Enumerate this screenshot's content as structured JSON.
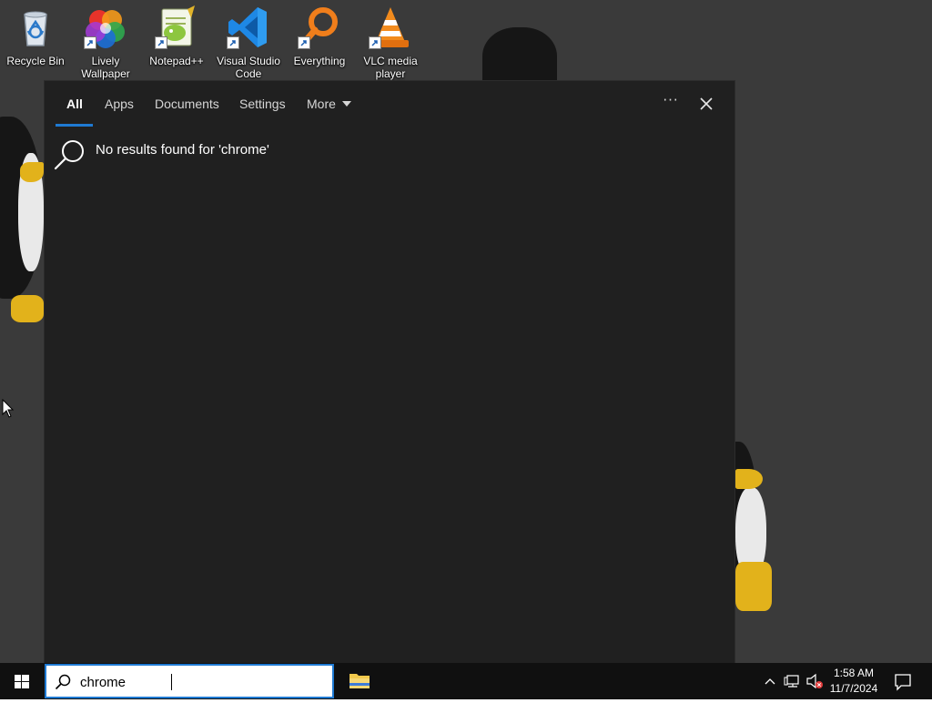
{
  "desktop": {
    "icons": [
      {
        "label": "Recycle Bin",
        "icon": "recycle-bin-icon"
      },
      {
        "label": "Lively Wallpaper",
        "icon": "lively-wallpaper-icon"
      },
      {
        "label": "Notepad++",
        "icon": "notepad-plus-plus-icon"
      },
      {
        "label": "Visual Studio Code",
        "icon": "vscode-icon"
      },
      {
        "label": "Everything",
        "icon": "everything-search-icon"
      },
      {
        "label": "VLC media player",
        "icon": "vlc-icon"
      }
    ]
  },
  "search_panel": {
    "tabs": [
      {
        "label": "All",
        "active": true
      },
      {
        "label": "Apps"
      },
      {
        "label": "Documents"
      },
      {
        "label": "Settings"
      },
      {
        "label": "More"
      }
    ],
    "more_options": "···",
    "no_results": "No results found for 'chrome'"
  },
  "taskbar": {
    "search_value": "chrome",
    "clock": {
      "time": "1:58 AM",
      "date": "11/7/2024"
    }
  },
  "colors": {
    "accent": "#1f7ad3",
    "panel_bg": "#202020",
    "taskbar_bg": "#101010",
    "desktop_bg": "#3a3a3a"
  }
}
